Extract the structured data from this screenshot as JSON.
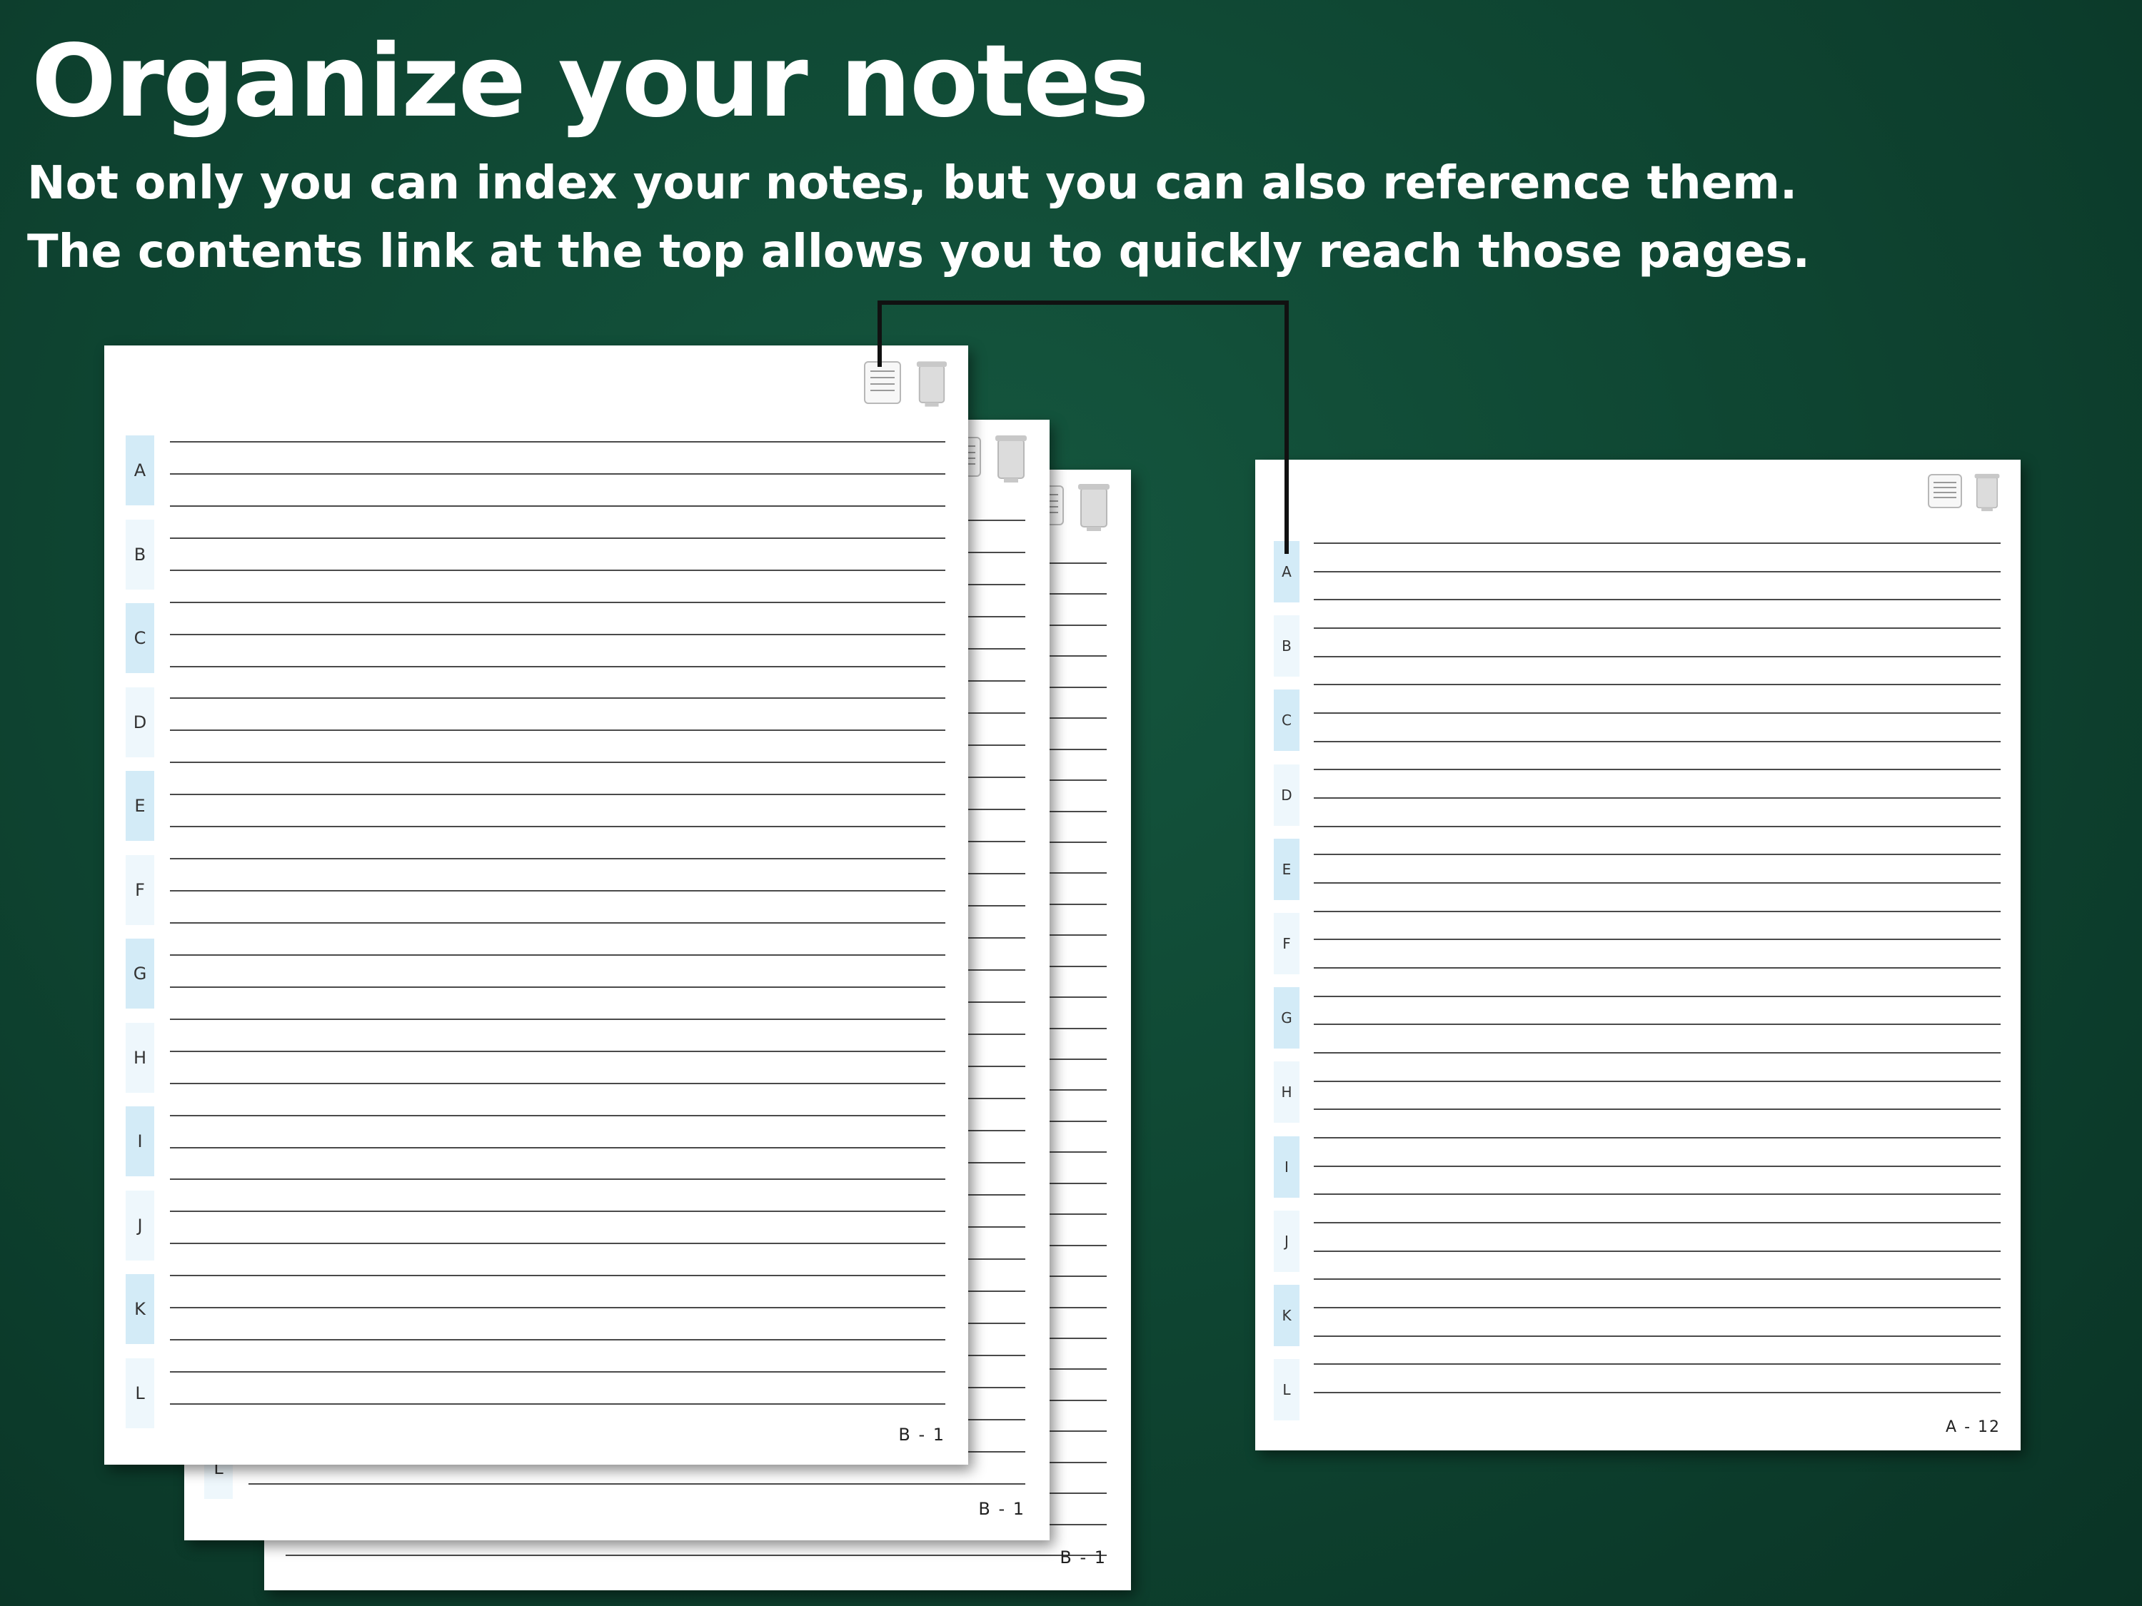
{
  "header": {
    "title": "Organize your notes",
    "subtitle_line1": "Not only you can index your notes, but you can also reference them.",
    "subtitle_line2": "The contents link at the top allows you to quickly reach those pages."
  },
  "tab_letters": [
    "A",
    "B",
    "C",
    "D",
    "E",
    "F",
    "G",
    "H",
    "I",
    "J",
    "K",
    "L"
  ],
  "pages": {
    "back": {
      "number": "B - 1"
    },
    "middle": {
      "number": "B - 1",
      "visible_tab": "L"
    },
    "front": {
      "number": "B - 1"
    },
    "right": {
      "number": "A - 12"
    }
  },
  "icons": {
    "contents": "contents-list-icon",
    "trash": "trash-icon"
  },
  "colors": {
    "background": "#0f4733",
    "tab_dark": "#d3ebf7",
    "tab_light": "#eef7fc",
    "connector": "#111111"
  }
}
